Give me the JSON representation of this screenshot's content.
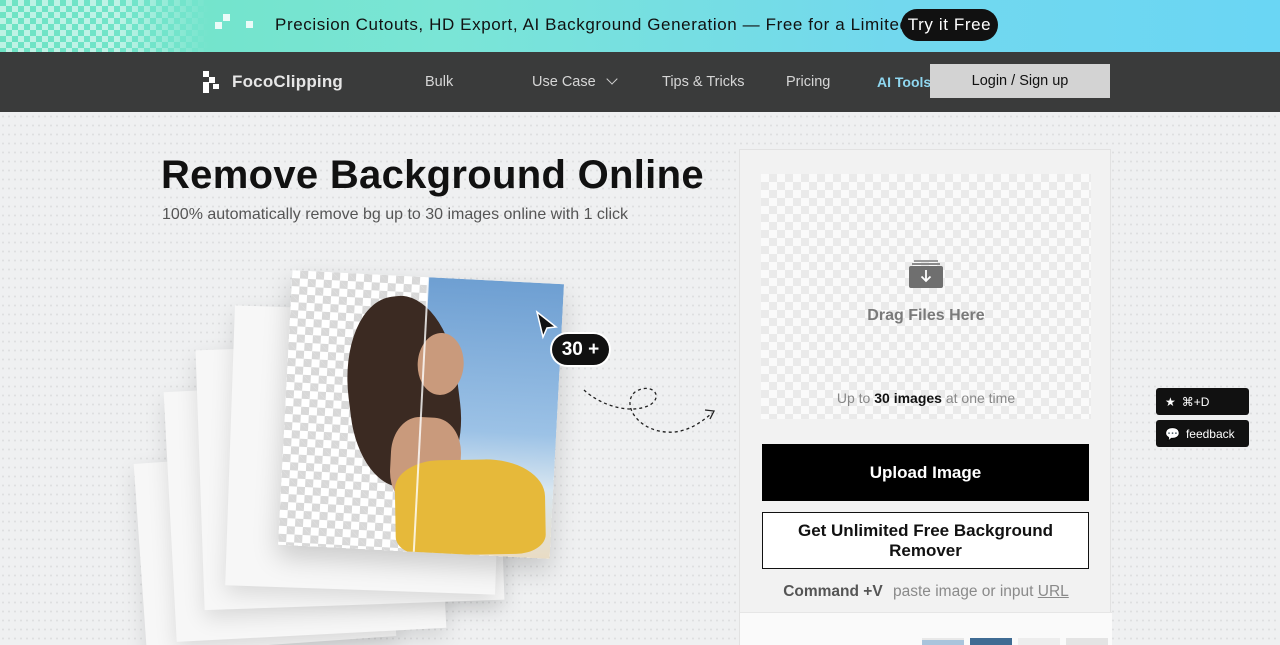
{
  "promo": {
    "text": "Precision Cutouts, HD Export, AI Background Generation — Free for a Limited Time",
    "cta": "Try it Free"
  },
  "nav": {
    "logo": "FocoClipping",
    "links": [
      "Bulk",
      "Use Case",
      "Tips & Tricks",
      "Pricing"
    ],
    "ai_tools": "AI Tools",
    "login": "Login / Sign up"
  },
  "hero": {
    "title": "Remove Background Online",
    "subtitle": "100% automatically remove bg up to 30 images online with 1 click",
    "badge": "30 +"
  },
  "upload": {
    "drag_label": "Drag Files Here",
    "note_prefix": "Up to",
    "note_bold": "30 images",
    "note_suffix": "at one time",
    "upload_button": "Upload Image",
    "unlimited_button": "Get Unlimited Free Background Remover",
    "paste_bold": "Command +V",
    "paste_text": "paste image or input",
    "paste_link": "URL"
  },
  "side": {
    "shortcut": "⌘+D",
    "feedback": "feedback"
  },
  "colors": {
    "promo_start": "#6ee3c4",
    "promo_end": "#6ad6f4",
    "nav_bg": "#3a3b3b",
    "primary": "#000000"
  },
  "icons": [
    "logo-mark-icon",
    "chevron-down-icon",
    "sparkle-icon",
    "cursor-arrow-icon",
    "download-tray-icon",
    "star-icon",
    "chat-bubble-icon"
  ]
}
